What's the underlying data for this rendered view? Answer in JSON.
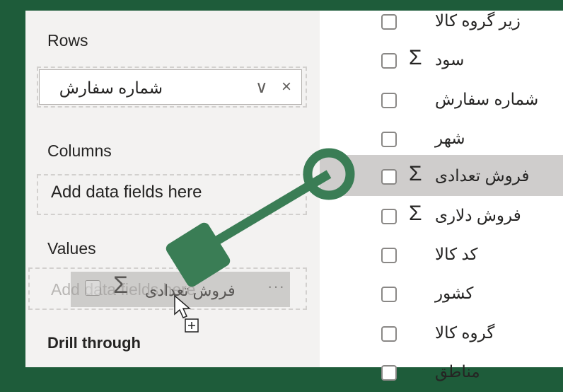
{
  "build": {
    "rows_label": "Rows",
    "rows_field": "شماره سفارش",
    "columns_label": "Columns",
    "columns_placeholder": "Add data fields here",
    "values_label": "Values",
    "values_placeholder": "Add data fields here",
    "dragging_field": "فروش تعدادی",
    "drill_label": "Drill through"
  },
  "fields": [
    {
      "name": "زیر گروه کالا",
      "measure": false
    },
    {
      "name": "سود",
      "measure": true
    },
    {
      "name": "شماره سفارش",
      "measure": false
    },
    {
      "name": "شهر",
      "measure": false
    },
    {
      "name": "فروش تعدادی",
      "measure": true,
      "highlighted": true
    },
    {
      "name": "فروش دلاری",
      "measure": true
    },
    {
      "name": "کد کالا",
      "measure": false
    },
    {
      "name": "کشور",
      "measure": false
    },
    {
      "name": "گروه کالا",
      "measure": false
    },
    {
      "name": "مناطق",
      "measure": false
    }
  ],
  "icons": {
    "sigma": "Σ",
    "chevron": "∨",
    "close": "×",
    "more": "···"
  },
  "colors": {
    "background": "#1e5c3a",
    "annotation_green": "#3a7d55",
    "highlight_row": "#cfcdcc"
  }
}
